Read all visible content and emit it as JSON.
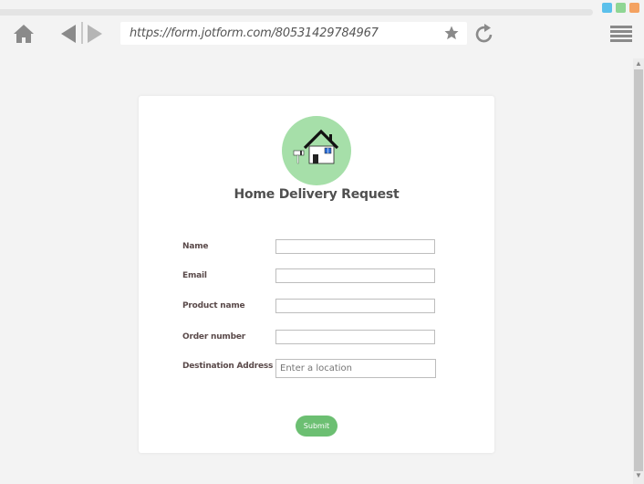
{
  "browser": {
    "url": "https://form.jotform.com/80531429784967",
    "window_dots": {
      "blue": "#5bc0eb",
      "green": "#8fd694",
      "orange": "#f4a261"
    },
    "icons": [
      "home-icon",
      "back-icon",
      "forward-icon",
      "star-icon",
      "reload-icon",
      "menu-icon"
    ]
  },
  "form": {
    "title": "Home Delivery Request",
    "accent": "#6cbf72",
    "logo_bg": "#a6dfa9",
    "fields": [
      {
        "label": "Name",
        "value": "",
        "placeholder": ""
      },
      {
        "label": "Email",
        "value": "",
        "placeholder": ""
      },
      {
        "label": "Product name",
        "value": "",
        "placeholder": ""
      },
      {
        "label": "Order number",
        "value": "",
        "placeholder": ""
      },
      {
        "label": "Destination Address",
        "value": "",
        "placeholder": "Enter a location"
      }
    ],
    "submit_label": "Submit"
  }
}
